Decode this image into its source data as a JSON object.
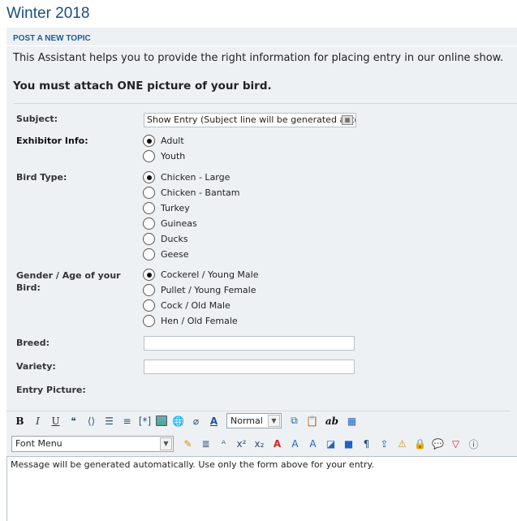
{
  "page": {
    "title": "Winter 2018"
  },
  "panel": {
    "header": "POST A NEW TOPIC",
    "intro": "This Assistant helps you to provide the right information for placing entry in our online show.",
    "must_attach": "You must attach ONE picture of your bird."
  },
  "form": {
    "subject": {
      "label": "Subject:",
      "value": "Show Entry (Subject line will be generated auto"
    },
    "exhibitor": {
      "label": "Exhibitor Info:",
      "options": [
        "Adult",
        "Youth"
      ],
      "selected": "Adult"
    },
    "bird_type": {
      "label": "Bird Type:",
      "options": [
        "Chicken - Large",
        "Chicken - Bantam",
        "Turkey",
        "Guineas",
        "Ducks",
        "Geese"
      ],
      "selected": "Chicken - Large"
    },
    "gender": {
      "label": "Gender / Age of your Bird:",
      "options": [
        "Cockerel / Young Male",
        "Pullet / Young Female",
        "Cock / Old Male",
        "Hen / Old Female"
      ],
      "selected": "Cockerel / Young Male"
    },
    "breed": {
      "label": "Breed:",
      "value": ""
    },
    "variety": {
      "label": "Variety:",
      "value": ""
    },
    "entry_picture": {
      "label": "Entry Picture:"
    }
  },
  "editor": {
    "toolbar1": {
      "bold": "B",
      "italic": "I",
      "underline": "U",
      "ab": "ab",
      "size_select": "Normal"
    },
    "toolbar2": {
      "font_select": "Font Menu"
    },
    "message": "Message will be generated automatically. Use only the form above for your entry."
  }
}
